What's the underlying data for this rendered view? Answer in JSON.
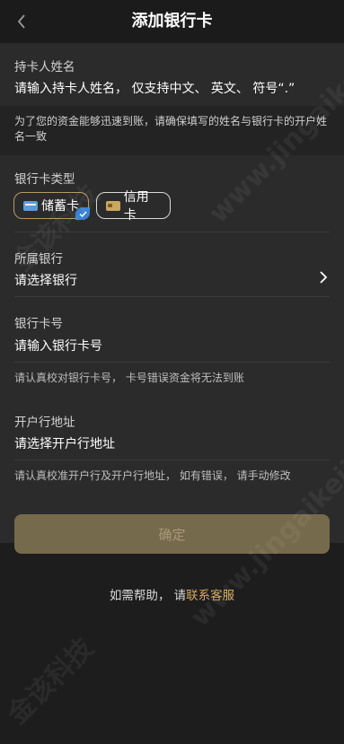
{
  "header": {
    "title": "添加银行卡"
  },
  "holder": {
    "label": "持卡人姓名",
    "placeholder": "请输入持卡人姓名， 仅支持中文、 英文、 符号“.”"
  },
  "notice": "为了您的资金能够迅速到账，请确保填写的姓名与银行卡的开户姓名一致",
  "card_type": {
    "label": "银行卡类型",
    "options": [
      {
        "label": "储蓄卡",
        "selected": true
      },
      {
        "label": "信用卡",
        "selected": false
      }
    ]
  },
  "bank": {
    "label": "所属银行",
    "placeholder": "请选择银行"
  },
  "card_number": {
    "label": "银行卡号",
    "placeholder": "请输入银行卡号",
    "hint": "请认真校对银行卡号， 卡号错误资金将无法到账"
  },
  "branch": {
    "label": "开户行地址",
    "placeholder": "请选择开户行地址",
    "hint": "请认真校准开户行及开户行地址， 如有错误， 请手动修改"
  },
  "confirm_label": "确定",
  "help": {
    "prefix": "如需帮助， 请",
    "link": "联系客服"
  },
  "watermark": {
    "cn": "金该科技",
    "url": "www.jingaikeji.com"
  },
  "colors": {
    "accent": "#d4a95f",
    "button_bg": "#766a4c",
    "panel": "#2b2b2b"
  }
}
